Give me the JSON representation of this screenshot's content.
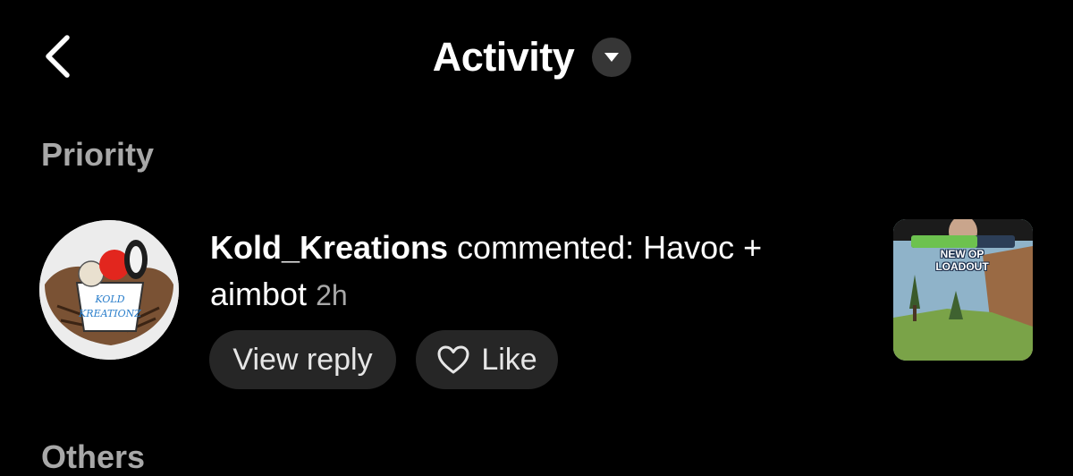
{
  "header": {
    "title": "Activity",
    "back_icon": "chevron-left-icon",
    "dropdown_icon": "caret-down-icon"
  },
  "sections": {
    "priority": "Priority",
    "others": "Others"
  },
  "notification": {
    "username": "Kold_Kreations",
    "message": " commented: Havoc + aimbot",
    "time": "2h",
    "avatar_text_1": "KOLD",
    "avatar_text_2": "KREATIONZ",
    "actions": {
      "view_reply": "View reply",
      "like": "Like",
      "like_icon": "heart-outline-icon"
    },
    "thumbnail": {
      "line1": "NEW OP",
      "line2": "LOADOUT"
    }
  },
  "colors": {
    "background": "#000000",
    "secondary_text": "#a8a8a8",
    "pill_bg": "#262626",
    "dropdown_bg": "#363636"
  }
}
